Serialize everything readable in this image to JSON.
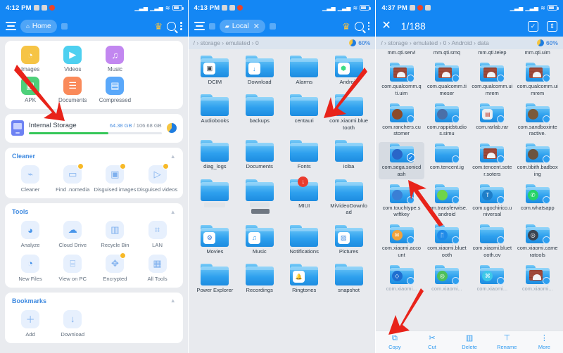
{
  "panels": {
    "left": {
      "status": {
        "time": "4:12 PM"
      },
      "appbar": {
        "tab_label": "Home",
        "menu_icon": "hamburger-icon",
        "crown_icon": "crown-icon",
        "search_icon": "search-icon",
        "overflow_icon": "kebab-menu-icon"
      },
      "categories": [
        {
          "label": "Images",
          "icon": "image-icon",
          "color": "#f6c445",
          "glyph": "◔"
        },
        {
          "label": "Videos",
          "icon": "video-icon",
          "color": "#4ed0f0",
          "glyph": "▶"
        },
        {
          "label": "Music",
          "icon": "music-icon",
          "color": "#c287f0",
          "glyph": "♫"
        },
        {
          "label": "APK",
          "icon": "apk-icon",
          "color": "#4ed07a",
          "glyph": "▣"
        },
        {
          "label": "Documents",
          "icon": "document-icon",
          "color": "#fa8a5a",
          "glyph": "☰"
        },
        {
          "label": "Compressed",
          "icon": "archive-icon",
          "color": "#5aa8fa",
          "glyph": "▤"
        }
      ],
      "storage": {
        "name": "Internal Storage",
        "used": "64.38 GB",
        "separator": "/",
        "total": "106.68 GB",
        "used_percent": 60,
        "icon": "internal-storage-icon"
      },
      "cleaner": {
        "title": "Cleaner",
        "collapse_icon": "chevron-up-icon",
        "items": [
          {
            "label": "Cleaner",
            "icon": "broom-icon",
            "glyph": "🧹",
            "badge": false
          },
          {
            "label": "Find .nomedia",
            "icon": "nomedia-icon",
            "glyph": "▭",
            "badge": true
          },
          {
            "label": "Disguised images",
            "icon": "disguised-images-icon",
            "glyph": "▣",
            "badge": true
          },
          {
            "label": "Disguised videos",
            "icon": "disguised-videos-icon",
            "glyph": "▷",
            "badge": true
          }
        ]
      },
      "tools": {
        "title": "Tools",
        "collapse_icon": "chevron-up-icon",
        "items": [
          {
            "label": "Analyze",
            "icon": "pie-chart-icon",
            "glyph": "◕",
            "badge": false
          },
          {
            "label": "Cloud Drive",
            "icon": "cloud-icon",
            "glyph": "☁",
            "badge": false
          },
          {
            "label": "Recycle Bin",
            "icon": "trash-icon",
            "glyph": "🗑",
            "badge": false
          },
          {
            "label": "LAN",
            "icon": "lan-icon",
            "glyph": "⌗",
            "badge": false
          },
          {
            "label": "New Files",
            "icon": "clock-icon",
            "glyph": "◔",
            "badge": false
          },
          {
            "label": "View on PC",
            "icon": "monitor-icon",
            "glyph": "⌸",
            "badge": false
          },
          {
            "label": "Encrypted",
            "icon": "shield-icon",
            "glyph": "✦",
            "badge": true
          },
          {
            "label": "All Tools",
            "icon": "grid-icon",
            "glyph": "∷",
            "badge": false
          }
        ]
      },
      "bookmarks": {
        "title": "Bookmarks",
        "collapse_icon": "chevron-up-icon",
        "items": [
          {
            "label": "Add",
            "icon": "plus-icon",
            "glyph": "＋"
          },
          {
            "label": "Download",
            "icon": "download-icon",
            "glyph": "↓"
          }
        ]
      }
    },
    "middle": {
      "status": {
        "time": "4:13 PM"
      },
      "appbar": {
        "tab_label": "Local",
        "close_tab_icon": "close-icon",
        "crown_icon": "crown-icon",
        "search_icon": "search-icon",
        "overflow_icon": "kebab-menu-icon"
      },
      "breadcrumb": "/ › storage › emulated › 0",
      "storage_percent": "60%",
      "files": [
        {
          "name": "DCIM",
          "overlay": "camera-icon",
          "glyph": "▣",
          "redacted": false,
          "cloud": true
        },
        {
          "name": "Download",
          "overlay": "download-icon",
          "glyph": "↓",
          "redacted": false,
          "cloud": true
        },
        {
          "name": "Alarms",
          "overlay": "",
          "glyph": "",
          "redacted": false
        },
        {
          "name": "Android",
          "overlay": "android-icon",
          "glyph": "⬢",
          "redacted": false
        },
        {
          "name": "Audiobooks",
          "overlay": "",
          "glyph": "",
          "redacted": false
        },
        {
          "name": "backups",
          "overlay": "",
          "glyph": "",
          "redacted": false
        },
        {
          "name": "centauri",
          "overlay": "",
          "glyph": "",
          "redacted": false
        },
        {
          "name": "com.xiaomi.bluetooth",
          "overlay": "",
          "glyph": "",
          "redacted": false
        },
        {
          "name": "diag_logs",
          "overlay": "",
          "glyph": "",
          "redacted": false
        },
        {
          "name": "Documents",
          "overlay": "",
          "glyph": "",
          "redacted": false
        },
        {
          "name": "Fonts",
          "overlay": "",
          "glyph": "",
          "redacted": false
        },
        {
          "name": "iciba",
          "overlay": "",
          "glyph": "",
          "redacted": false
        },
        {
          "name": "",
          "overlay": "",
          "glyph": "",
          "redacted": "light"
        },
        {
          "name": "",
          "overlay": "",
          "glyph": "",
          "redacted": "mixed"
        },
        {
          "name": "MIUI",
          "overlay": "download-badge-icon",
          "glyph": "↓",
          "redacted": false,
          "dl": true
        },
        {
          "name": "MiVideoDownload",
          "overlay": "",
          "glyph": "",
          "redacted": false
        },
        {
          "name": "Movies",
          "overlay": "movie-icon",
          "glyph": "⚙",
          "redacted": false
        },
        {
          "name": "Music",
          "overlay": "music-icon",
          "glyph": "♫",
          "redacted": false
        },
        {
          "name": "Notifications",
          "overlay": "",
          "glyph": "",
          "redacted": false
        },
        {
          "name": "Pictures",
          "overlay": "picture-icon",
          "glyph": "▨",
          "redacted": false
        },
        {
          "name": "Power Explorer",
          "overlay": "",
          "glyph": "",
          "redacted": false
        },
        {
          "name": "Recordings",
          "overlay": "",
          "glyph": "",
          "redacted": false
        },
        {
          "name": "Ringtones",
          "overlay": "bell-icon",
          "glyph": "🔔",
          "redacted": false
        },
        {
          "name": "snapshot",
          "overlay": "",
          "glyph": "",
          "redacted": false
        }
      ]
    },
    "right": {
      "status": {
        "time": "4:37 PM"
      },
      "appbar": {
        "close_icon": "close-icon",
        "selection_count": "1/188",
        "select_all_icon": "select-all-icon",
        "sort_icon": "sort-icon"
      },
      "breadcrumb": "/ › storage › emulated › 0 › Android › data",
      "storage_percent": "60%",
      "files": [
        {
          "name": "mm.qti.servi",
          "overlay": "",
          "glyph": "",
          "partial": true
        },
        {
          "name": "mm.qti.smq",
          "overlay": "",
          "glyph": "",
          "partial": true
        },
        {
          "name": "mm.qti.telep",
          "overlay": "",
          "glyph": "",
          "partial": true
        },
        {
          "name": "mm.qti.uim",
          "overlay": "",
          "glyph": "",
          "partial": true
        },
        {
          "name": "com.qualcomm.qti.uim",
          "overlay": "brick-icon",
          "glyph": "",
          "brick": true,
          "selected": false
        },
        {
          "name": "com.qualcomm.timeser",
          "overlay": "brick-icon",
          "glyph": "",
          "brick": true
        },
        {
          "name": "com.qualcomm.uimrem",
          "overlay": "brick-icon",
          "glyph": "",
          "brick": true
        },
        {
          "name": "com.qualcomm.uimrem",
          "overlay": "brick-icon",
          "glyph": "",
          "brick": true
        },
        {
          "name": "com.ranchers.customer",
          "overlay": "app-icon",
          "glyph": "◉",
          "color": "#8c4b2a"
        },
        {
          "name": "com.rappidstudios.simu",
          "overlay": "app-icon",
          "glyph": "◈",
          "color": "#4a6fa8"
        },
        {
          "name": "com.rarlab.rar",
          "overlay": "rar-icon",
          "glyph": "▤",
          "color": "#e8e8e8"
        },
        {
          "name": "com.sandboxinteractive.",
          "overlay": "app-icon",
          "glyph": "◕",
          "color": "#7a5a3a"
        },
        {
          "name": "com.sega.sonicdash",
          "overlay": "sonic-icon",
          "glyph": "●",
          "color": "#2a66c8",
          "selected": true
        },
        {
          "name": "com.tencent.ig",
          "overlay": "",
          "glyph": ""
        },
        {
          "name": "com.tencent.soter.soters",
          "overlay": "brick-icon",
          "glyph": "",
          "brick": true
        },
        {
          "name": "com.tibith.badboxing",
          "overlay": "app-icon",
          "glyph": "◍",
          "color": "#6b5440"
        },
        {
          "name": "com.touchtype.swiftkey",
          "overlay": "swiftkey-icon",
          "glyph": "◐",
          "color": "#3a7fd5"
        },
        {
          "name": "com.transferwise.android",
          "overlay": "wise-icon",
          "glyph": "✓",
          "color": "#6fd44a"
        },
        {
          "name": "com.ugochirico.universal",
          "overlay": "universal-icon",
          "glyph": "T",
          "color": "#1f7ec8"
        },
        {
          "name": "com.whatsapp",
          "overlay": "whatsapp-icon",
          "glyph": "✆",
          "color": "#25d366"
        },
        {
          "name": "com.xiaomi.account",
          "overlay": "account-icon",
          "glyph": "✉",
          "color": "#f0a33c"
        },
        {
          "name": "com.xiaomi.bluetooth",
          "overlay": "bluetooth-icon",
          "glyph": "ᛦ",
          "color": "#1f8ae8"
        },
        {
          "name": "com.xiaomi.bluetooth.ov",
          "overlay": "",
          "glyph": ""
        },
        {
          "name": "com.xiaomi.cameratools",
          "overlay": "camera-icon",
          "glyph": "◎",
          "color": "#3b4450"
        },
        {
          "name": "com.xiaomi...",
          "overlay": "app-icon",
          "glyph": "◇",
          "color": "#1f6fd0",
          "faded": true
        },
        {
          "name": "com.xiaomi...",
          "overlay": "app-icon",
          "glyph": "◎",
          "color": "#4ec05a",
          "faded": true
        },
        {
          "name": "com.xiaomi...",
          "overlay": "game-icon",
          "glyph": "⌘",
          "color": "#3ec8e8",
          "faded": true
        },
        {
          "name": "com.xiaomi...",
          "overlay": "brick-icon",
          "glyph": "",
          "brick": true,
          "faded": true
        }
      ],
      "actions": [
        {
          "label": "Copy",
          "icon": "copy-icon",
          "glyph": "⧉"
        },
        {
          "label": "Cut",
          "icon": "cut-icon",
          "glyph": "✂"
        },
        {
          "label": "Delete",
          "icon": "delete-icon",
          "glyph": "🗑"
        },
        {
          "label": "Rename",
          "icon": "rename-icon",
          "glyph": "T"
        },
        {
          "label": "More",
          "icon": "more-icon",
          "glyph": "⋮"
        }
      ]
    }
  },
  "colors": {
    "accent": "#1487f4",
    "arrow": "#e8231a",
    "progress": "#35c759",
    "selected": "#d6dbe2"
  }
}
